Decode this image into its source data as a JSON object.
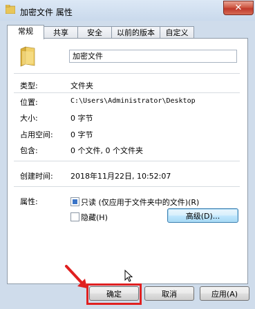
{
  "window": {
    "title": "加密文件 属性",
    "close_symbol": "✕"
  },
  "tabs": [
    {
      "label": "常规",
      "active": true
    },
    {
      "label": "共享"
    },
    {
      "label": "安全"
    },
    {
      "label": "以前的版本"
    },
    {
      "label": "自定义"
    }
  ],
  "general": {
    "name": "加密文件",
    "fields": {
      "type_label": "类型:",
      "type_value": "文件夹",
      "location_label": "位置:",
      "location_value": "C:\\Users\\Administrator\\Desktop",
      "size_label": "大小:",
      "size_value": "0 字节",
      "disk_label": "占用空间:",
      "disk_value": "0 字节",
      "contains_label": "包含:",
      "contains_value": "0 个文件, 0 个文件夹",
      "created_label": "创建时间:",
      "created_value": "2018年11月22日, 10:52:07",
      "attributes_label": "属性:"
    },
    "attributes": {
      "readonly_label": "只读 (仅应用于文件夹中的文件)(R)",
      "readonly_checked": true,
      "hidden_label": "隐藏(H)",
      "hidden_checked": false,
      "advanced_button": "高级(D)..."
    }
  },
  "buttons": {
    "ok": "确定",
    "cancel": "取消",
    "apply": "应用(A)"
  },
  "colors": {
    "highlight_box": "#e02020",
    "window_frame": "#cfdceb"
  }
}
